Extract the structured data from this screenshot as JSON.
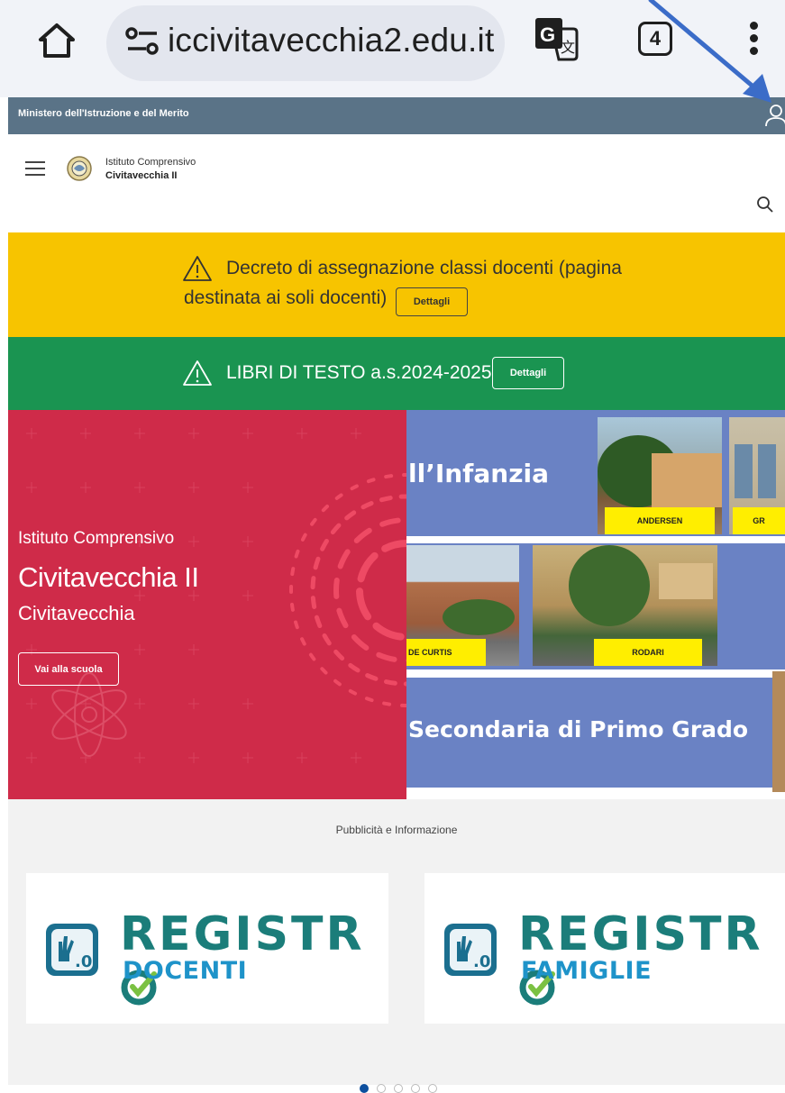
{
  "browser": {
    "url": "iccivitavecchia2.edu.it",
    "tab_count": "4"
  },
  "ministry_bar": {
    "text": "Ministero dell'Istruzione e del Merito"
  },
  "header": {
    "school_small": "Istituto Comprensivo",
    "school_name": "Civitavecchia II"
  },
  "banners": [
    {
      "line1": "Decreto di assegnazione classi docenti (pagina",
      "line2": "destinata ai soli docenti)",
      "button": "Dettagli",
      "color": "#f7c400"
    },
    {
      "line1": "LIBRI DI TESTO a.s.2024-2025",
      "button": "Dettagli",
      "color": "#1a9451"
    }
  ],
  "hero": {
    "pretitle": "Istituto Comprensivo",
    "title": "Civitavecchia II",
    "subtitle": "Civitavecchia",
    "button": "Vai alla scuola",
    "color": "#cf2b49",
    "slide": {
      "heading_top": "ll’Infanzia",
      "heading_bottom": "Secondaria di Primo Grado",
      "labels": [
        "ANDERSEN",
        "GR",
        "DE CURTIS",
        "RODARI"
      ]
    }
  },
  "pubblicita": {
    "title": "Pubblicità e Informazione",
    "cards": [
      {
        "word": "REGISTR",
        "sub": "DOCENTI"
      },
      {
        "word": "REGISTR",
        "sub": "FAMIGLIE"
      }
    ],
    "slide_count": 5,
    "active_slide": 1
  }
}
